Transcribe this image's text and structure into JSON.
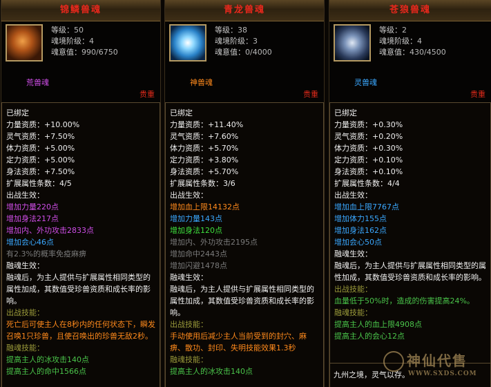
{
  "cards": [
    {
      "title": "锦鳞兽魂",
      "level_label": "等级：",
      "level": "50",
      "rank_label": "魂境阶级：",
      "rank": "4",
      "will_label": "魂意值：",
      "will": "990/6750",
      "kind": "荒兽魂",
      "kind_color": "#d04ee8",
      "rarity": "贵重",
      "lines": [
        {
          "t": "已绑定",
          "c": "w"
        },
        {
          "t": "力量资质：+10.00%",
          "c": "w"
        },
        {
          "t": "灵气资质：+7.50%",
          "c": "w"
        },
        {
          "t": "体力资质：+5.00%",
          "c": "w"
        },
        {
          "t": "定力资质：+5.00%",
          "c": "w"
        },
        {
          "t": "身法资质：+7.50%",
          "c": "w"
        },
        {
          "t": "扩展属性条数：4/5",
          "c": "w"
        },
        {
          "t": "出战生效：",
          "c": "w"
        },
        {
          "t": "增加力量220点",
          "c": "pur"
        },
        {
          "t": "增加身法217点",
          "c": "pur"
        },
        {
          "t": "增加内、外功攻击2833点",
          "c": "pur"
        },
        {
          "t": "增加会心46点",
          "c": "blu"
        },
        {
          "t": "有2.3%的概率免疫麻痹",
          "c": "gry"
        },
        {
          "t": "融魂生效：",
          "c": "w"
        },
        {
          "t": "融魂后，为主人提供与扩展属性相同类型的属性加成，其数值受珍兽资质和成长率的影响。",
          "c": "w",
          "wrap": true
        },
        {
          "t": "出战技能：",
          "c": "sk"
        },
        {
          "t": "死亡后可使主人在8秒内的任何状态下，瞬发召唤1只珍兽，且使召唤出的珍兽无敌2秒。",
          "c": "ora",
          "wrap": true
        },
        {
          "t": "融魂技能：",
          "c": "sk"
        },
        {
          "t": "提高主人的冰攻击140点",
          "c": "gtx"
        },
        {
          "t": "提高主人的命中1566点",
          "c": "gtx"
        }
      ]
    },
    {
      "title": "青龙兽魂",
      "level_label": "等级：",
      "level": "38",
      "rank_label": "魂境阶级：",
      "rank": "3",
      "will_label": "魂意值：",
      "will": "0/4000",
      "kind": "神兽魂",
      "kind_color": "#ff8a1c",
      "rarity": "贵重",
      "lines": [
        {
          "t": "已绑定",
          "c": "w"
        },
        {
          "t": "力量资质：+11.40%",
          "c": "w"
        },
        {
          "t": "灵气资质：+7.60%",
          "c": "w"
        },
        {
          "t": "体力资质：+5.70%",
          "c": "w"
        },
        {
          "t": "定力资质：+3.80%",
          "c": "w"
        },
        {
          "t": "身法资质：+5.70%",
          "c": "w"
        },
        {
          "t": "扩展属性条数：3/6",
          "c": "w"
        },
        {
          "t": "出战生效：",
          "c": "w"
        },
        {
          "t": "增加血上限14132点",
          "c": "ora"
        },
        {
          "t": "增加力量143点",
          "c": "blu"
        },
        {
          "t": "增加身法120点",
          "c": "grn"
        },
        {
          "t": "增加内、外功攻击2195点",
          "c": "gry"
        },
        {
          "t": "增加命中2443点",
          "c": "gry"
        },
        {
          "t": "增加闪避1478点",
          "c": "gry"
        },
        {
          "t": "融魂生效：",
          "c": "w"
        },
        {
          "t": "融魂后，为主人提供与扩展属性相同类型的属性加成，其数值受珍兽资质和成长率的影响。",
          "c": "w",
          "wrap": true
        },
        {
          "t": "出战技能：",
          "c": "sk"
        },
        {
          "t": "手动使用后减少主人当前受到的封穴、麻痹、散功、封印、失明技能效果1.3秒",
          "c": "ora",
          "wrap": true
        },
        {
          "t": "融魂技能：",
          "c": "sk"
        },
        {
          "t": "提高主人的冰攻击140点",
          "c": "gtx"
        }
      ]
    },
    {
      "title": "苍狼兽魂",
      "level_label": "等级：",
      "level": "2",
      "rank_label": "魂境阶级：",
      "rank": "4",
      "will_label": "魂意值：",
      "will": "430/4500",
      "kind": "灵兽魂",
      "kind_color": "#3aa8ff",
      "rarity": "贵重",
      "lines": [
        {
          "t": "已绑定",
          "c": "w"
        },
        {
          "t": "力量资质：+0.30%",
          "c": "w"
        },
        {
          "t": "灵气资质：+0.20%",
          "c": "w"
        },
        {
          "t": "体力资质：+0.30%",
          "c": "w"
        },
        {
          "t": "定力资质：+0.10%",
          "c": "w"
        },
        {
          "t": "身法资质：+0.10%",
          "c": "w"
        },
        {
          "t": "扩展属性条数：4/4",
          "c": "w"
        },
        {
          "t": "出战生效：",
          "c": "w"
        },
        {
          "t": "增加血上限7767点",
          "c": "blu"
        },
        {
          "t": "增加体力155点",
          "c": "blu"
        },
        {
          "t": "增加身法162点",
          "c": "blu"
        },
        {
          "t": "增加会心50点",
          "c": "blu"
        },
        {
          "t": "融魂生效：",
          "c": "w"
        },
        {
          "t": "融魂后，为主人提供与扩展属性相同类型的属性加成，其数值受珍兽资质和成长率的影响。",
          "c": "w",
          "wrap": true
        },
        {
          "t": "出战技能：",
          "c": "sk"
        },
        {
          "t": "血量低于50%时，造成的伤害提高24%。",
          "c": "gtx"
        },
        {
          "t": "融魂技能：",
          "c": "sk"
        },
        {
          "t": "提高主人的血上限4908点",
          "c": "gtx"
        },
        {
          "t": "提高主人的会心12点",
          "c": "gtx"
        }
      ],
      "extra": "九州之境，灵气以存。"
    }
  ],
  "watermark": {
    "name": "神仙代售",
    "url": "WWW.SXDS.COM"
  }
}
